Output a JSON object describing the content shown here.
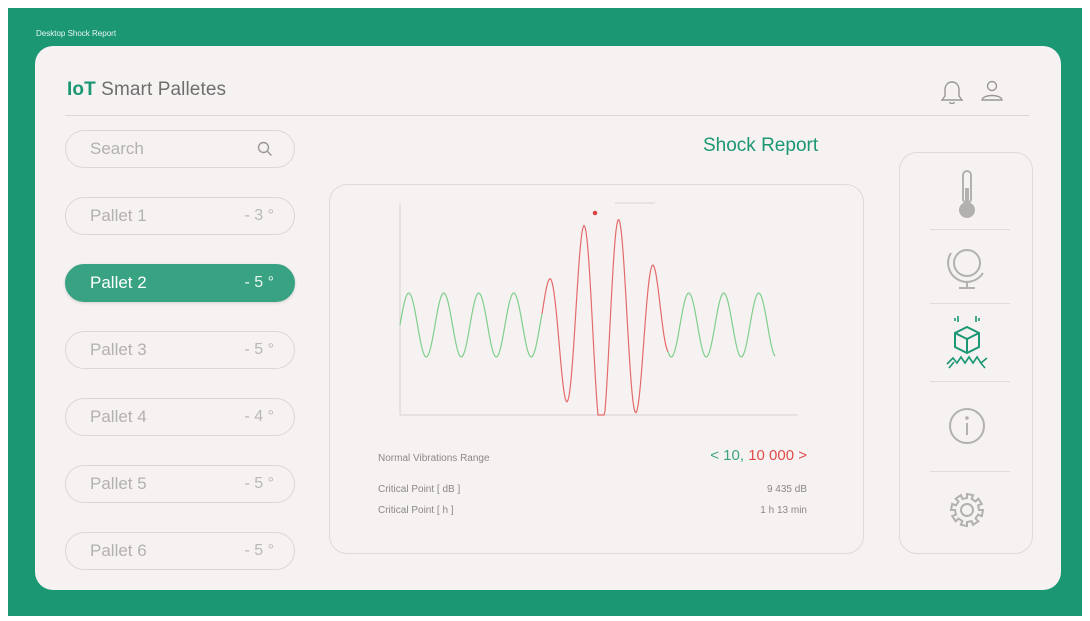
{
  "window": {
    "title": "Desktop Shock Report"
  },
  "header": {
    "brand_bold": "IoT",
    "brand_rest": " Smart Palletes",
    "icons": [
      "bell-icon",
      "user-icon"
    ]
  },
  "search": {
    "placeholder": "Search",
    "icon": "search-icon"
  },
  "pallets": [
    {
      "label": "Pallet 1",
      "temp": "- 3 °",
      "active": false
    },
    {
      "label": "Pallet 2",
      "temp": "- 5 °",
      "active": true
    },
    {
      "label": "Pallet 3",
      "temp": "- 5 °",
      "active": false
    },
    {
      "label": "Pallet 4",
      "temp": "- 4 °",
      "active": false
    },
    {
      "label": "Pallet 5",
      "temp": "- 5 °",
      "active": false
    },
    {
      "label": "Pallet 6",
      "temp": "- 5 °",
      "active": false
    }
  ],
  "main": {
    "title": "Shock Report",
    "range_label": "Normal Vibrations Range",
    "range_open": "< 10, ",
    "range_close": "10 000 >",
    "critical_db_label": "Critical Point [ dB ]",
    "critical_db_value": "9 435 dB",
    "critical_h_label": "Critical Point [ h ]",
    "critical_h_value": "1 h 13 min"
  },
  "rail": {
    "icons": [
      "thermometer-icon",
      "globe-icon",
      "shock-box-icon",
      "info-icon",
      "settings-icon"
    ],
    "active_icon": "shock-box-icon"
  },
  "colors": {
    "brand": "#1b9774",
    "accent": "#38a283",
    "normal": "#3aa57c",
    "critical": "#e04b4b",
    "card": "#f7f2f2"
  }
}
